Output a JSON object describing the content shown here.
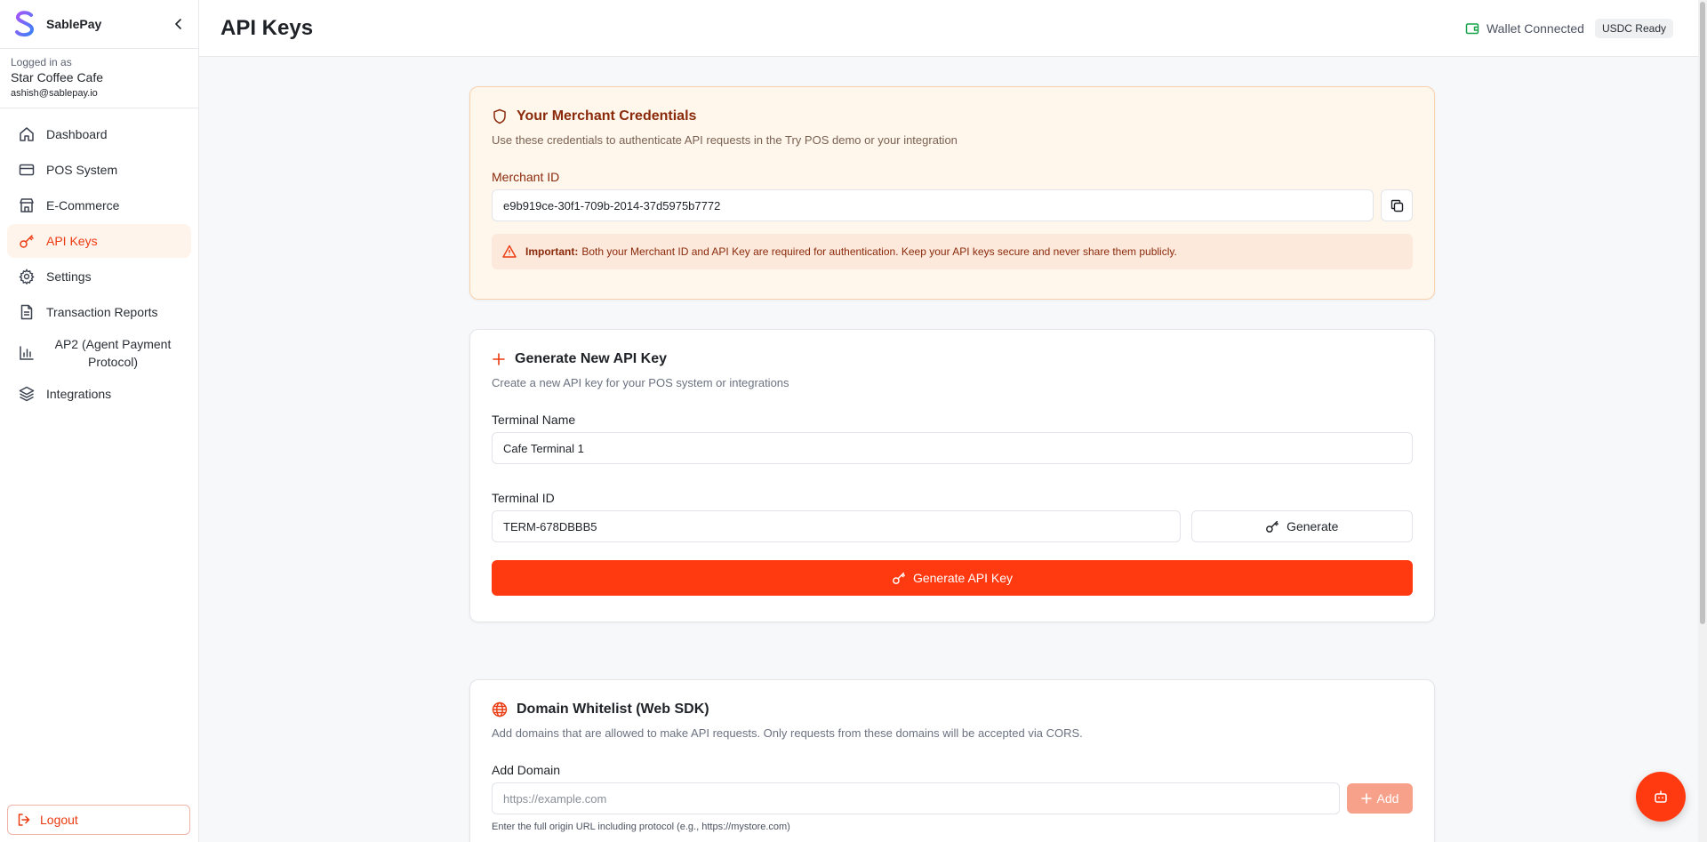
{
  "brand": {
    "name": "SablePay"
  },
  "account": {
    "logged_in_label": "Logged in as",
    "business": "Star Coffee Cafe",
    "email": "ashish@sablepay.io"
  },
  "nav": [
    {
      "label": "Dashboard",
      "icon": "home-icon"
    },
    {
      "label": "POS System",
      "icon": "credit-card-icon"
    },
    {
      "label": "E-Commerce",
      "icon": "store-icon"
    },
    {
      "label": "API Keys",
      "icon": "key-icon",
      "active": true
    },
    {
      "label": "Settings",
      "icon": "gear-icon"
    },
    {
      "label": "Transaction Reports",
      "icon": "file-icon"
    },
    {
      "label": "AP2 (Agent Payment Protocol)",
      "icon": "bar-chart-icon"
    },
    {
      "label": "Integrations",
      "icon": "layers-icon"
    }
  ],
  "logout_label": "Logout",
  "header": {
    "title": "API Keys",
    "wallet_status": "Wallet Connected",
    "usdc_badge": "USDC Ready"
  },
  "credentials": {
    "title": "Your Merchant Credentials",
    "subtitle": "Use these credentials to authenticate API requests in the Try POS demo or your integration",
    "merchant_id_label": "Merchant ID",
    "merchant_id": "e9b919ce-30f1-709b-2014-37d5975b7772",
    "alert_strong": "Important:",
    "alert_text": "Both your Merchant ID and API Key are required for authentication. Keep your API keys secure and never share them publicly."
  },
  "generate": {
    "title": "Generate New API Key",
    "subtitle": "Create a new API key for your POS system or integrations",
    "terminal_name_label": "Terminal Name",
    "terminal_name": "Cafe Terminal 1",
    "terminal_id_label": "Terminal ID",
    "terminal_id": "TERM-678DBBB5",
    "generate_button": "Generate",
    "generate_api_key_button": "Generate API Key"
  },
  "domains": {
    "title": "Domain Whitelist (Web SDK)",
    "subtitle": "Add domains that are allowed to make API requests. Only requests from these domains will be accepted via CORS.",
    "add_label": "Add Domain",
    "placeholder": "https://example.com",
    "add_button": "Add",
    "hint": "Enter the full origin URL including protocol (e.g., https://mystore.com)"
  },
  "colors": {
    "accent": "#ff3a10",
    "active_bg": "#fff4ec",
    "credentials_bg": "#fff6ec",
    "wallet_green": "#16a34a"
  }
}
